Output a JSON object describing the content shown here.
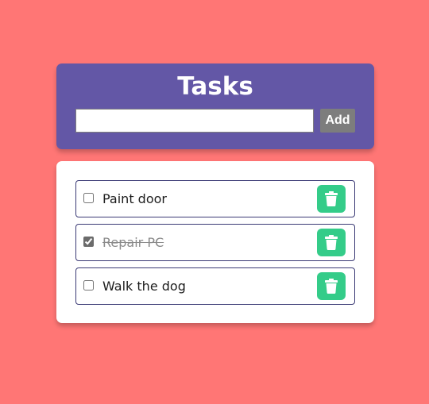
{
  "header": {
    "title": "Tasks",
    "input_value": "",
    "input_placeholder": "",
    "add_label": "Add"
  },
  "tasks": [
    {
      "text": "Paint door",
      "done": false
    },
    {
      "text": "Repair PC",
      "done": true
    },
    {
      "text": "Walk the dog",
      "done": false
    }
  ],
  "icons": {
    "delete": "trash-icon"
  },
  "colors": {
    "background": "#ff7675",
    "header": "#6357a6",
    "delete_button": "#34cc89",
    "add_button": "#7d7d7d",
    "item_border": "#3b3a75"
  }
}
